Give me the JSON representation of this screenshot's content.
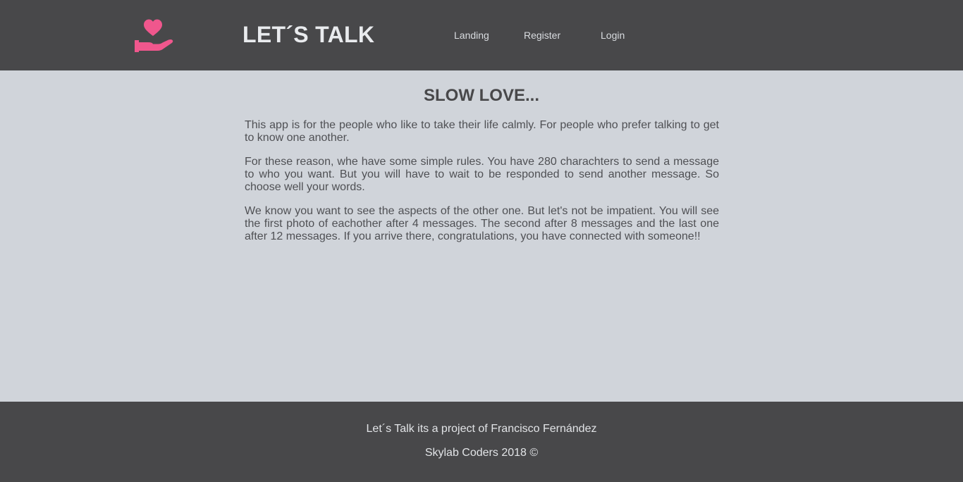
{
  "header": {
    "logo_icon": "hand-heart-icon",
    "brand": "LET´S TALK",
    "nav": [
      {
        "label": "Landing"
      },
      {
        "label": "Register"
      },
      {
        "label": "Login"
      }
    ]
  },
  "main": {
    "title": "SLOW LOVE...",
    "paragraphs": [
      "This app is for the people who like to take their life calmly. For people who prefer talking to get to know one another.",
      "For these reason, whe have some simple rules. You have 280 charachters to send a message to who you want. But you will have to wait to be responded to send another message. So choose well your words.",
      "We know you want to see the aspects of the other one. But let's not be impatient. You will see the first photo of eachother after 4 messages. The second after 8 messages and the last one after 12 messages. If you arrive there, congratulations, you have connected with someone!!"
    ]
  },
  "footer": {
    "line1": "Let´s Talk its a project of Francisco Fernández",
    "line2": "Skylab Coders 2018 ©"
  },
  "colors": {
    "header_bg": "#48484a",
    "body_bg": "#d0d4da",
    "accent_pink": "#f0578d",
    "text_dark": "#48484a"
  }
}
